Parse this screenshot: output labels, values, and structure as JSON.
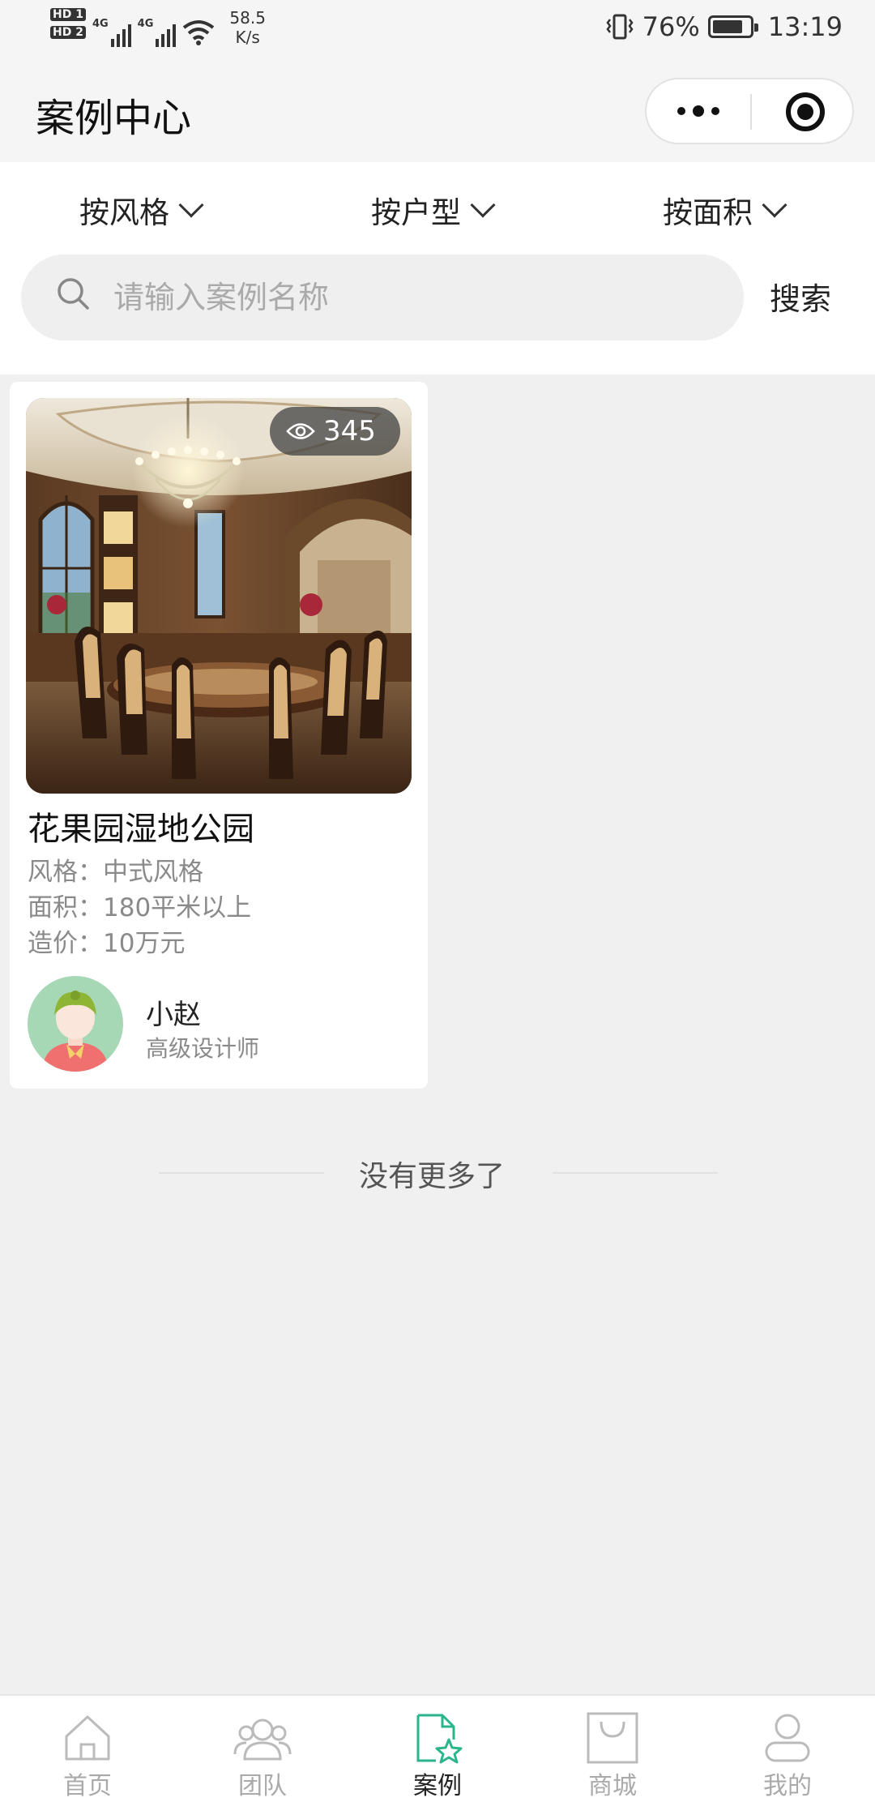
{
  "status_bar": {
    "hd1": "HD 1",
    "hd2": "HD 2",
    "net1": "4G",
    "net2": "4G",
    "speed": "58.5",
    "speed_unit": "K/s",
    "battery": "76%",
    "time": "13:19"
  },
  "header": {
    "title": "案例中心"
  },
  "filters": [
    {
      "label": "按风格"
    },
    {
      "label": "按户型"
    },
    {
      "label": "按面积"
    }
  ],
  "search": {
    "placeholder": "请输入案例名称",
    "value": "",
    "button": "搜索"
  },
  "cases": [
    {
      "views": "345",
      "title": "花果园湿地公园",
      "style": "风格：中式风格",
      "area": "面积：180平米以上",
      "price": "造价：10万元",
      "designer_name": "小赵",
      "designer_title": "高级设计师"
    }
  ],
  "list_end": "没有更多了",
  "tabs": [
    {
      "label": "首页",
      "icon": "home-icon"
    },
    {
      "label": "团队",
      "icon": "team-icon"
    },
    {
      "label": "案例",
      "icon": "case-icon"
    },
    {
      "label": "商城",
      "icon": "shop-icon"
    },
    {
      "label": "我的",
      "icon": "profile-icon"
    }
  ],
  "colors": {
    "accent": "#2bb58a",
    "page_bg": "#f0f0f0",
    "muted_text": "#8a8a8a"
  }
}
